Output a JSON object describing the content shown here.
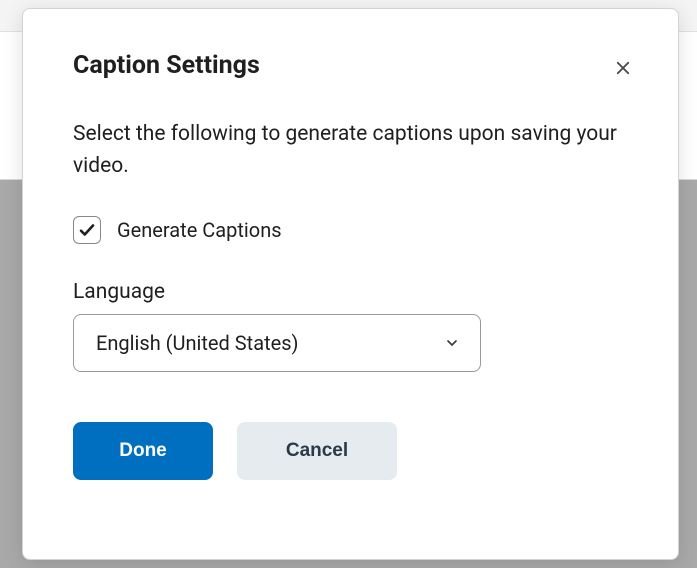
{
  "dialog": {
    "title": "Caption Settings",
    "description": "Select the following to generate captions upon saving your video.",
    "generateCaptions": {
      "label": "Generate Captions",
      "checked": true
    },
    "language": {
      "label": "Language",
      "selected": "English (United States)"
    },
    "buttons": {
      "done": "Done",
      "cancel": "Cancel"
    }
  }
}
